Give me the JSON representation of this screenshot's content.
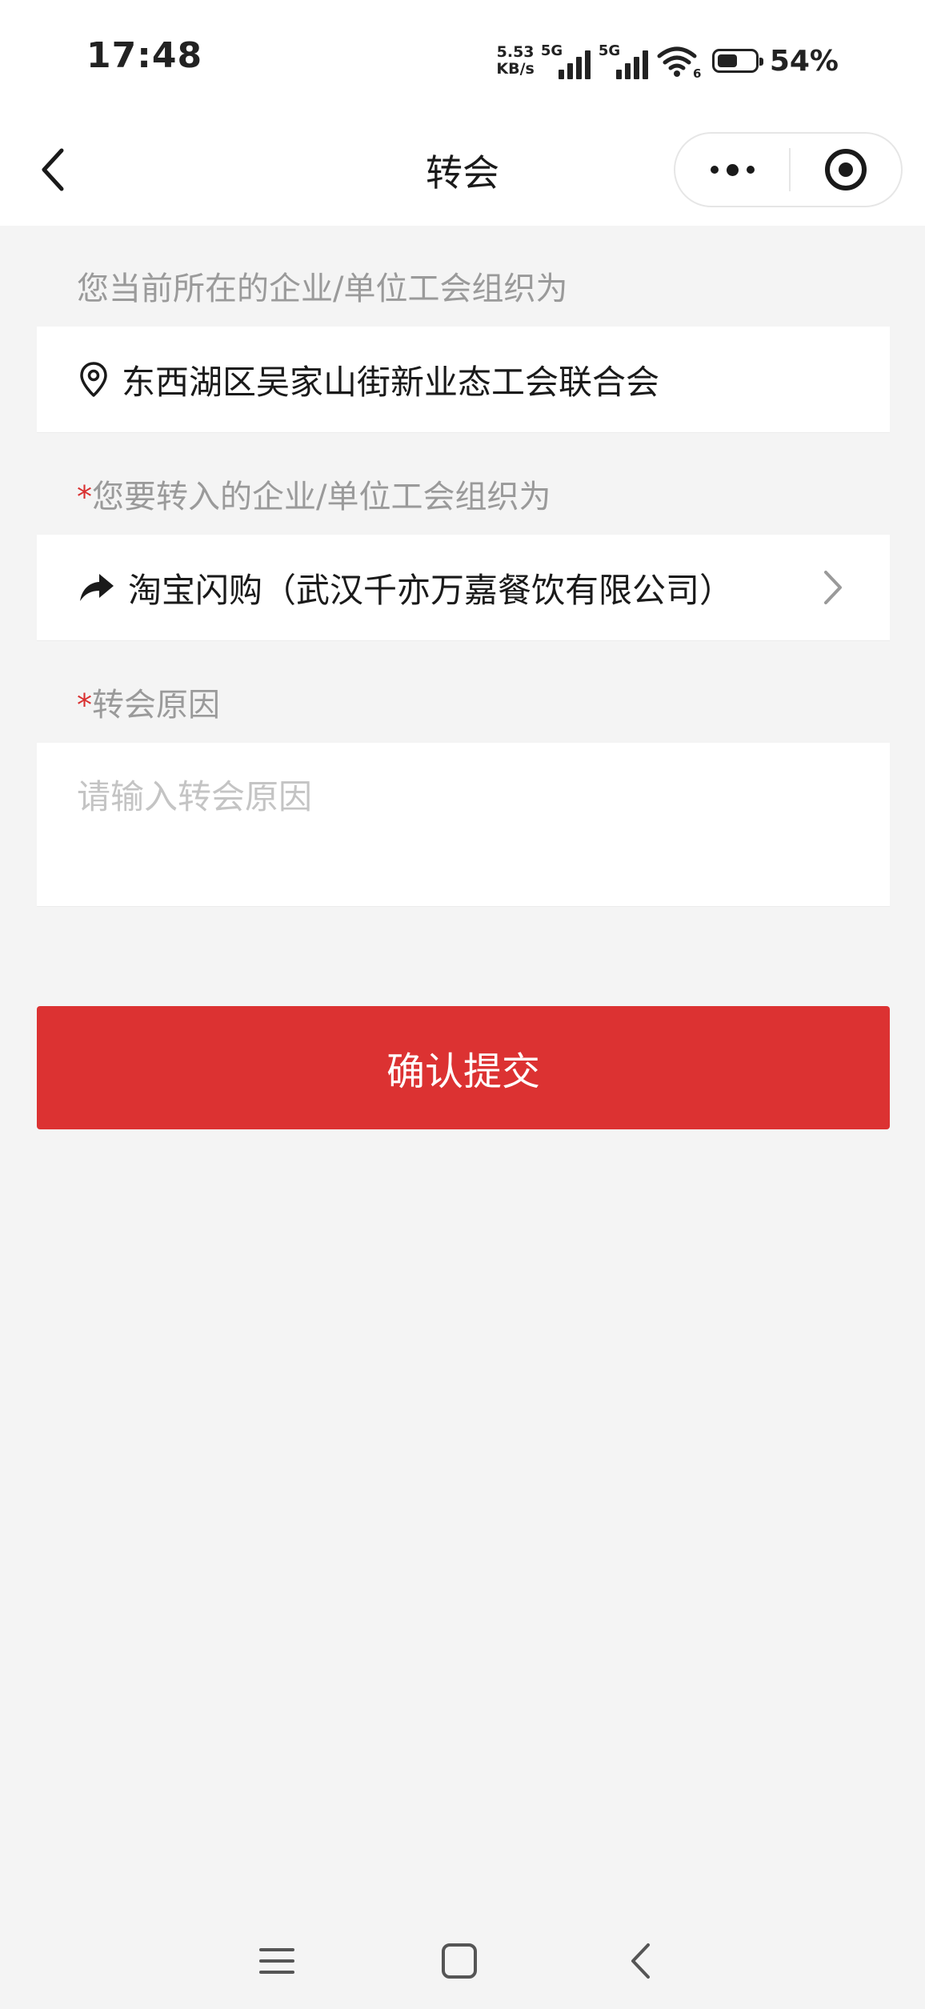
{
  "status_bar": {
    "time": "17:48",
    "net_speed_value": "5.53",
    "net_speed_unit": "KB/s",
    "signal1_label": "5G",
    "signal2_label": "5G",
    "wifi_sub": "6",
    "battery_percent": "54%",
    "battery_level": 0.54
  },
  "nav": {
    "title": "转会",
    "back_icon": "chevron-left-icon",
    "more_icon": "more-dots-icon",
    "close_icon": "target-icon"
  },
  "form": {
    "current_org_label": "您当前所在的企业/单位工会组织为",
    "current_org_value": "东西湖区吴家山街新业态工会联合会",
    "current_org_icon": "location-pin-icon",
    "target_org_required": "*",
    "target_org_label": "您要转入的企业/单位工会组织为",
    "target_org_value": "淘宝闪购（武汉千亦万嘉餐饮有限公司）",
    "target_org_icon": "share-arrow-icon",
    "reason_required": "*",
    "reason_label": "转会原因",
    "reason_value": "",
    "reason_placeholder": "请输入转会原因",
    "submit_label": "确认提交"
  },
  "colors": {
    "accent_red": "#dc3232",
    "required_red": "#d92f2f",
    "page_bg": "#f4f4f4",
    "card_bg": "#ffffff",
    "label_gray": "#9a9a9a",
    "placeholder_gray": "#c4c4c4"
  },
  "system_nav": {
    "menu_icon": "menu-lines-icon",
    "home_icon": "square-home-icon",
    "back_icon": "chevron-back-icon"
  }
}
